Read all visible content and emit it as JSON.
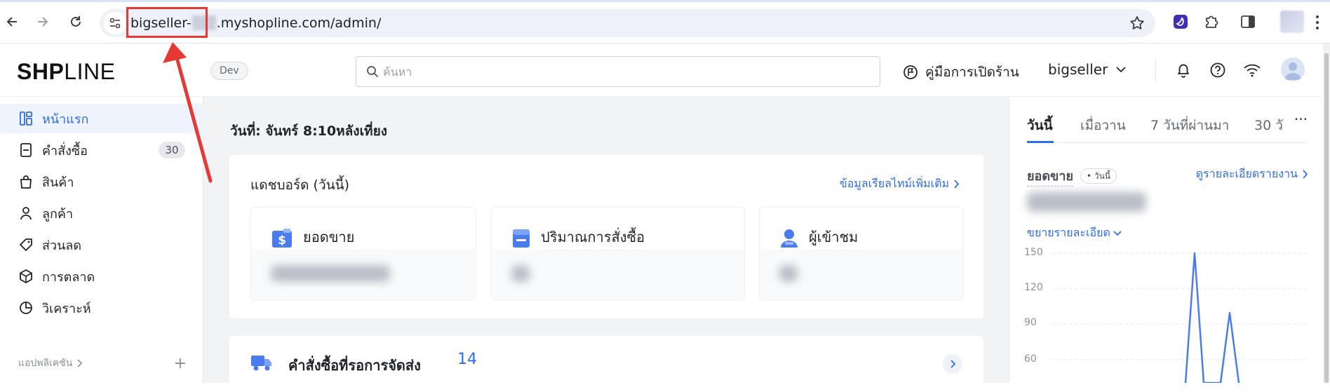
{
  "browser": {
    "url_prefix": "bigseller-",
    "url_suffix": ".myshopline.com/admin/",
    "icons": [
      "back-arrow-icon",
      "forward-arrow-icon",
      "reload-icon",
      "site-settings-icon",
      "bookmark-star-icon",
      "extension-icon",
      "puzzle-icon",
      "side-panel-icon"
    ]
  },
  "header": {
    "logo": {
      "part1": "SH",
      "part2": "P",
      "part3": "LINE"
    },
    "env_badge": "Dev",
    "search_placeholder": "ค้นหา",
    "guide_label": "คู่มือการเปิดร้าน",
    "store_name": "bigseller"
  },
  "sidebar": {
    "items": [
      {
        "label": "หน้าแรก",
        "icon": "dashboard-icon",
        "active": true
      },
      {
        "label": "คำสั่งซื้อ",
        "icon": "orders-icon",
        "count": "30"
      },
      {
        "label": "สินค้า",
        "icon": "bag-icon"
      },
      {
        "label": "ลูกค้า",
        "icon": "user-icon"
      },
      {
        "label": "ส่วนลด",
        "icon": "tag-icon"
      },
      {
        "label": "การตลาด",
        "icon": "cube-icon"
      },
      {
        "label": "วิเคราะห์",
        "icon": "pie-chart-icon"
      }
    ],
    "apps_label": "แอปพลิเคชัน"
  },
  "main": {
    "date_text": "วันที่: จันทร์ 8:10หลังเที่ยง",
    "dashboard": {
      "title": "แดชบอร์ด (วันนี้)",
      "more_link": "ข้อมูลเรียลไทม์เพิ่มเติม",
      "metrics": [
        {
          "label": "ยอดขาย",
          "icon": "dollar-card-icon"
        },
        {
          "label": "ปริมาณการสั่งซื้อ",
          "icon": "order-doc-icon"
        },
        {
          "label": "ผู้เข้าชม",
          "icon": "visitor-icon"
        }
      ]
    },
    "pending": {
      "title": "คำสั่งซื้อที่รอการจัดส่ง",
      "count": "14"
    }
  },
  "right_panel": {
    "tabs": [
      "วันนี้",
      "เมื่อวาน",
      "7 วันที่ผ่านมา",
      "30 วั"
    ],
    "more": "···",
    "sales_label": "ยอดขาย",
    "today_badge": "• วันนี้",
    "report_link": "ดูรายละเอียดรายงาน",
    "expand_link": "ขยายรายละเอียด",
    "chart_data": {
      "type": "line",
      "y_ticks": [
        "150",
        "120",
        "90",
        "60"
      ],
      "ylim": [
        60,
        150
      ],
      "series_color": "#4a7cf0"
    }
  },
  "colors": {
    "accent": "#2f6cf0",
    "annotation": "#e53935"
  }
}
